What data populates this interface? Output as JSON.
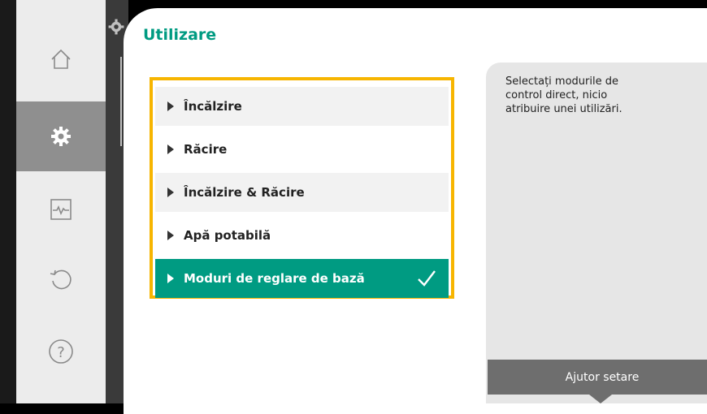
{
  "title": "Utilizare",
  "options": [
    {
      "label": "Încălzire",
      "selected": false
    },
    {
      "label": "Răcire",
      "selected": false
    },
    {
      "label": "Încălzire & Răcire",
      "selected": false
    },
    {
      "label": "Apă potabilă",
      "selected": false
    },
    {
      "label": "Moduri de reglare de bază",
      "selected": true
    }
  ],
  "help": {
    "text": "Selectați modurile de control direct, nicio atribuire unei utilizări.",
    "button_label": "Ajutor setare"
  },
  "rail": {
    "items": [
      "home-icon",
      "gear-icon",
      "monitor-icon",
      "undo-icon",
      "help-icon"
    ],
    "active": "gear-icon"
  },
  "colors": {
    "accent": "#009b82",
    "highlight_border": "#f7b500",
    "rail_active": "#8f8f8f",
    "help_button": "#6e6e6e"
  }
}
